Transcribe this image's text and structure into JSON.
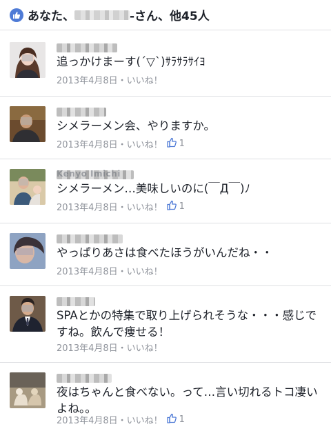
{
  "header": {
    "prefix": "あなた、",
    "suffix": "-さん、他45人"
  },
  "comments": [
    {
      "text": "追っかけまーす(´▽`)ｻﾗｻﾗｻｲﾖ",
      "date": "2013年4月8日",
      "like": "いいね！",
      "like_count": ""
    },
    {
      "text": "シメラーメン会、やりますか。",
      "date": "2013年4月8日",
      "like": "いいね！",
      "like_count": "1"
    },
    {
      "name": "Kenyo Imichi",
      "text": "シメラーメン…美味しいのに(￣Д￣)ﾉ",
      "date": "2013年4月8日",
      "like": "いいね！",
      "like_count": "1"
    },
    {
      "text": "やっぱりあさは食べたほうがいんだね・・",
      "date": "2013年4月8日",
      "like": "いいね！",
      "like_count": ""
    },
    {
      "text": "SPAとかの特集で取り上げられそうな・・・感じですね。飲んで痩せる！",
      "date": "2013年4月8日",
      "like": "いいね！",
      "like_count": ""
    },
    {
      "text": "夜はちゃんと食べない。って…言い切れるトコ凄いよね。。",
      "date": "2013年4月8日",
      "like": "いいね！",
      "like_count": "1"
    }
  ],
  "colors": {
    "accent": "#4f7bd6",
    "meta": "#90949c",
    "divider": "#dddfe2"
  }
}
